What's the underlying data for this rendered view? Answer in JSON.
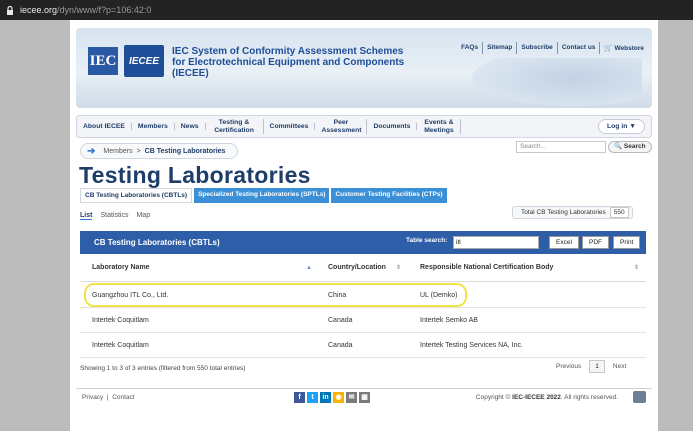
{
  "browser": {
    "url_host": "iecee.org",
    "url_path": "/dyn/www/f?p=106:42:0"
  },
  "banner": {
    "logo_iec": "IEC",
    "logo_iecee": "IECEE",
    "title_line1": "IEC System of Conformity Assessment Schemes",
    "title_line2": "for Electrotechnical Equipment and Components",
    "title_line3": "(IECEE)",
    "links": [
      "FAQs",
      "Sitemap",
      "Subscribe",
      "Contact us",
      "Webstore"
    ]
  },
  "nav": {
    "items": [
      "About IECEE",
      "Members",
      "News",
      "Testing & Certification",
      "Committees",
      "Peer Assessment",
      "Documents",
      "Events & Meetings"
    ],
    "login": "Log in ▼"
  },
  "breadcrumb": {
    "parent": "Members",
    "sep": ">",
    "current": "CB Testing Laboratories"
  },
  "search": {
    "placeholder": "Search...",
    "button": "Search"
  },
  "page_title": "Testing Laboratories",
  "tabs": [
    "CB Testing Laboratories (CBTLs)",
    "Specialized Testing Laboratories (SPTLs)",
    "Customer Testing Facilities (CTPs)"
  ],
  "subtabs": [
    "List",
    "Statistics",
    "Map"
  ],
  "total": {
    "label": "Total CB Testing Laboratories",
    "value": "550"
  },
  "table": {
    "title": "CB Testing Laboratories (CBTLs)",
    "search_label": "Table search:",
    "search_value": "itl",
    "buttons": [
      "Excel",
      "PDF",
      "Print"
    ],
    "columns": [
      "Laboratory Name",
      "Country/Location",
      "Responsible National Certification Body"
    ],
    "rows": [
      [
        "Guangzhou ITL Co., Ltd.",
        "China",
        "UL (Demko)"
      ],
      [
        "Intertek Coquitlam",
        "Canada",
        "Intertek Semko AB"
      ],
      [
        "Intertek Coquitlam",
        "Canada",
        "Intertek Testing Services NA, Inc."
      ]
    ],
    "info": "Showing 1 to 3 of 3 entries (filtered from 550 total entries)",
    "pager": {
      "previous": "Previous",
      "page": "1",
      "next": "Next"
    }
  },
  "footer": {
    "privacy": "Privacy",
    "contact": "Contact",
    "copyright_prefix": "Copyright ©",
    "copyright_bold": "IEC-IECEE 2022",
    "copyright_suffix": ". All rights reserved."
  },
  "colors": {
    "brand": "#1f3d6b",
    "table_header": "#2e5ea8",
    "tab_accent": "#3b8fd6",
    "highlight": "#f2e24a"
  }
}
